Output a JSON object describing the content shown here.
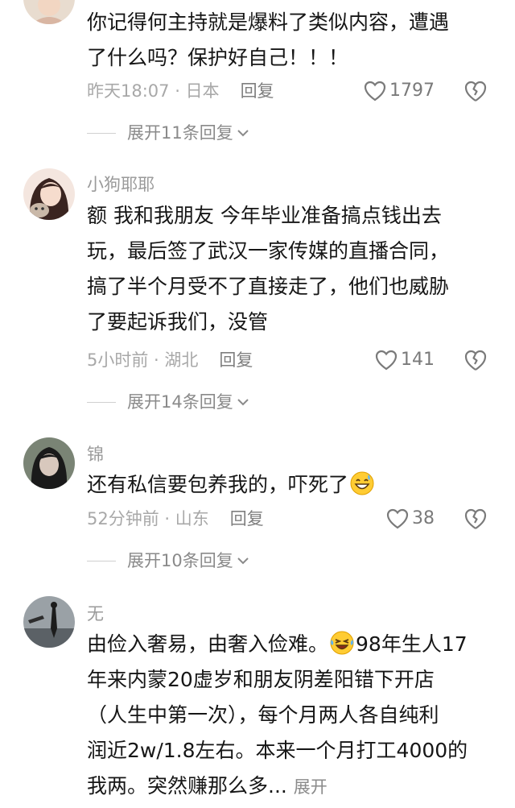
{
  "comments": [
    {
      "username": "",
      "content": "你记得何主持就是爆料了类似内容，遭遇\n了什么吗？保护好自己！！！",
      "time": "昨天18:07",
      "location": "日本",
      "reply_label": "回复",
      "likes": "1797",
      "expand_label": "展开11条回复"
    },
    {
      "username": "小狗耶耶",
      "content": "额 我和我朋友 今年毕业准备搞点钱出去\n玩，最后签了武汉一家传媒的直播合同，\n搞了半个月受不了直接走了，他们也威胁\n了要起诉我们，没管",
      "time": "5小时前",
      "location": "湖北",
      "reply_label": "回复",
      "likes": "141",
      "expand_label": "展开14条回复"
    },
    {
      "username": "锦",
      "content": "还有私信要包养我的，吓死了",
      "emoji": "grinning-sweat-emoji",
      "time": "52分钟前",
      "location": "山东",
      "reply_label": "回复",
      "likes": "38",
      "expand_label": "展开10条回复"
    },
    {
      "username": "无",
      "content_part1": "由俭入奢易，由奢入俭难。",
      "emoji": "rofl-emoji",
      "content_part2": "98年生人17\n年来内蒙20虚岁和朋友阴差阳错下开店\n（人生中第一次），每个月两人各自纯利\n润近2w/1.8左右。本来一个月打工4000的\n我两。突然赚那么多...",
      "more_label": "展开"
    }
  ],
  "colors": {
    "text": "#161616",
    "meta": "#a8a8a8",
    "icon": "#7a7a7a"
  }
}
